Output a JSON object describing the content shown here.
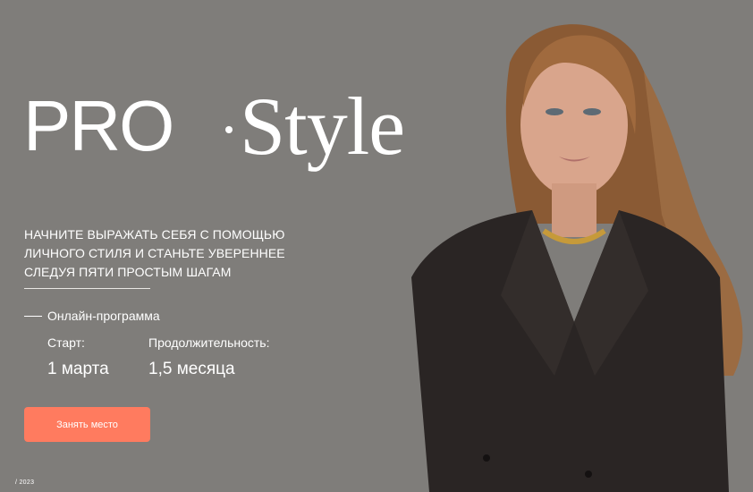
{
  "logo": {
    "pro": "PRO",
    "style": "Style"
  },
  "hero": {
    "tagline_line1": "НАЧНИТЕ ВЫРАЖАТЬ СЕБЯ С ПОМОЩЬЮ",
    "tagline_line2": "ЛИЧНОГО СТИЛЯ И СТАНЬТЕ УВЕРЕННЕЕ",
    "tagline_line3": "СЛЕДУЯ ПЯТИ ПРОСТЫМ ШАГАМ",
    "format": "Онлайн-программа",
    "start_label": "Старт:",
    "start_value": "1 марта",
    "duration_label": "Продолжительность:",
    "duration_value": "1,5 месяца",
    "cta_label": "Занять место"
  },
  "footer": {
    "year": "/ 2023"
  },
  "colors": {
    "background": "#7f7d7a",
    "accent": "#ff7b5f",
    "text": "#ffffff"
  }
}
